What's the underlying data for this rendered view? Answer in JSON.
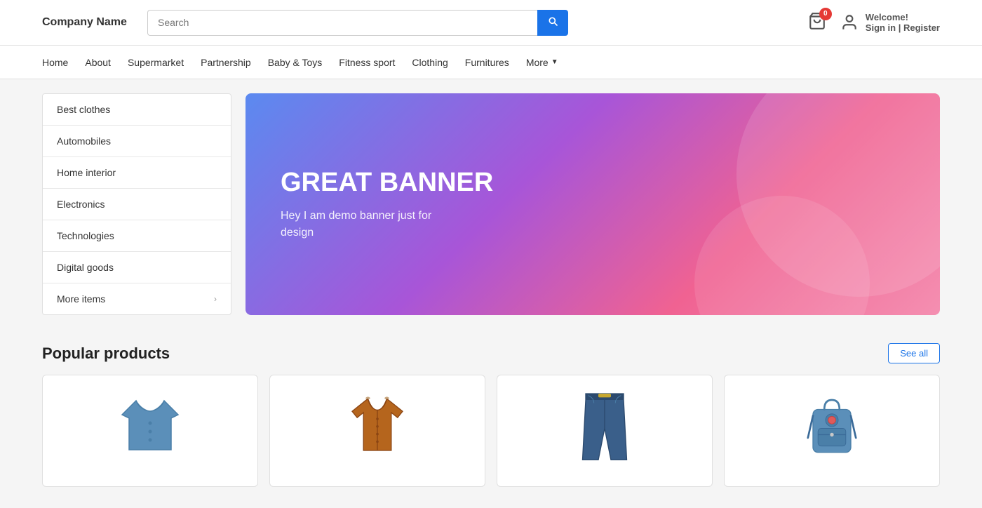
{
  "header": {
    "logo": "Company Name",
    "search_placeholder": "Search",
    "search_button_icon": "search-icon",
    "cart_badge": "0",
    "welcome_text": "Welcome!",
    "sign_in_text": "Sign in | Register"
  },
  "nav": {
    "items": [
      {
        "label": "Home",
        "id": "home"
      },
      {
        "label": "About",
        "id": "about"
      },
      {
        "label": "Supermarket",
        "id": "supermarket"
      },
      {
        "label": "Partnership",
        "id": "partnership"
      },
      {
        "label": "Baby &amp; Toys",
        "id": "baby"
      },
      {
        "label": "Fitness sport",
        "id": "fitness"
      },
      {
        "label": "Clothing",
        "id": "clothing"
      },
      {
        "label": "Furnitures",
        "id": "furnitures"
      }
    ],
    "more_label": "More"
  },
  "sidebar": {
    "items": [
      {
        "label": "Best clothes",
        "arrow": false
      },
      {
        "label": "Automobiles",
        "arrow": false
      },
      {
        "label": "Home interior",
        "arrow": false
      },
      {
        "label": "Electronics",
        "arrow": false
      },
      {
        "label": "Technologies",
        "arrow": false
      },
      {
        "label": "Digital goods",
        "arrow": false
      },
      {
        "label": "More items",
        "arrow": true
      }
    ]
  },
  "banner": {
    "title": "GREAT BANNER",
    "subtitle": "Hey I am demo banner just for design"
  },
  "popular": {
    "title": "Popular products",
    "see_all": "See all",
    "products": [
      {
        "id": "shirt",
        "type": "shirt"
      },
      {
        "id": "jacket",
        "type": "jacket"
      },
      {
        "id": "jeans",
        "type": "jeans"
      },
      {
        "id": "bag",
        "type": "bag"
      }
    ]
  }
}
